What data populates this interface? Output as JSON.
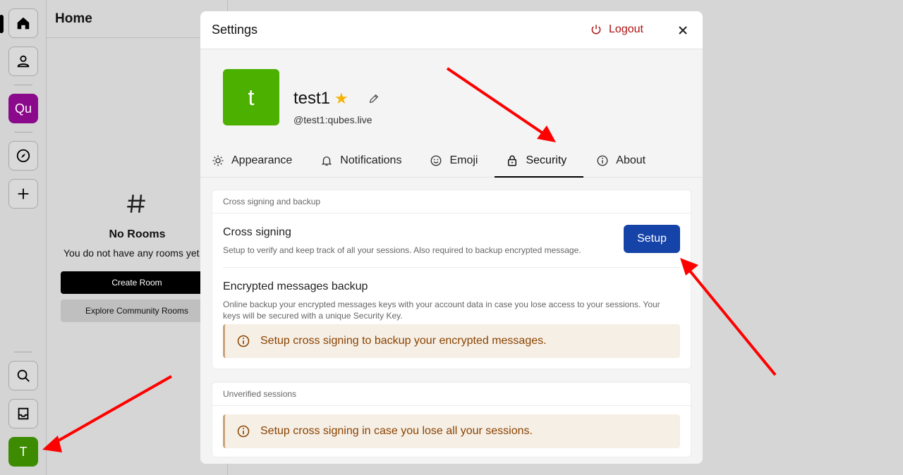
{
  "rooms": {
    "title": "Home",
    "empty_title": "No Rooms",
    "empty_subtitle": "You do not have any rooms yet",
    "create_label": "Create Room",
    "explore_label": "Explore Community Rooms"
  },
  "rail": {
    "space_initials": "Qu",
    "user_initial": "T"
  },
  "settings": {
    "title": "Settings",
    "logout_label": "Logout",
    "avatar_letter": "t",
    "display_name": "test1",
    "user_id": "@test1:qubes.live",
    "tabs": [
      {
        "label": "Appearance",
        "icon": "sun-icon"
      },
      {
        "label": "Notifications",
        "icon": "bell-icon"
      },
      {
        "label": "Emoji",
        "icon": "smiley-icon"
      },
      {
        "label": "Security",
        "icon": "lock-icon"
      },
      {
        "label": "About",
        "icon": "info-icon"
      }
    ],
    "active_tab": "Security",
    "cross_section": {
      "label": "Cross signing and backup",
      "cross_title": "Cross signing",
      "cross_desc": "Setup to verify and keep track of all your sessions. Also required to backup encrypted message.",
      "setup_label": "Setup",
      "backup_title": "Encrypted messages backup",
      "backup_desc": "Online backup your encrypted messages keys with your account data in case you lose access to your sessions. Your keys will be secured with a unique Security Key.",
      "backup_notice": "Setup cross signing to backup your encrypted messages."
    },
    "sessions_section": {
      "label": "Unverified sessions",
      "notice": "Setup cross signing in case you lose all your sessions."
    }
  },
  "colors": {
    "accent": "#1643a8",
    "logout": "#b01212",
    "avatar": "#4cb000",
    "space": "#8b0a8b",
    "annotation_arrow": "#ff0000"
  }
}
